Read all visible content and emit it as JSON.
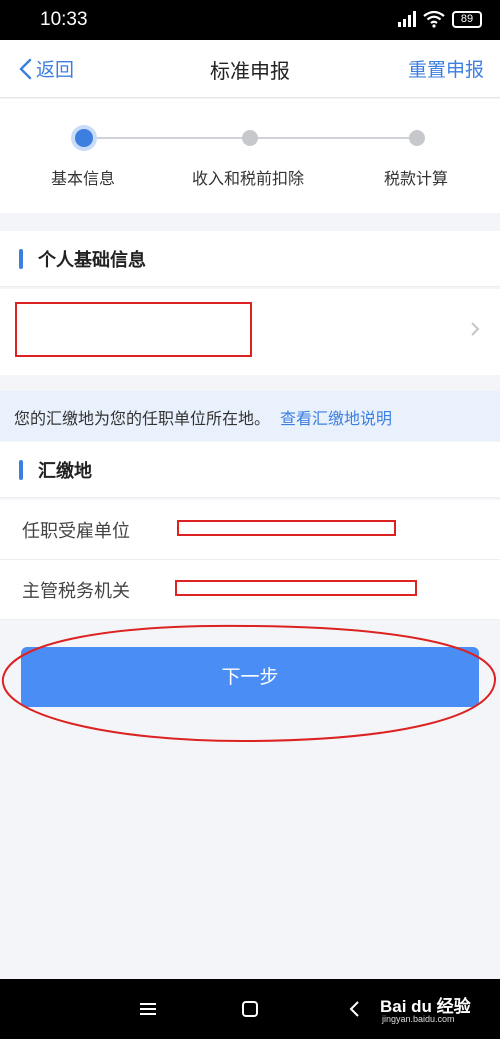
{
  "status_bar": {
    "time": "10:33",
    "battery": "89",
    "icons": [
      "signal-icon",
      "wifi-icon",
      "battery-icon"
    ]
  },
  "nav": {
    "back_label": "返回",
    "title": "标准申报",
    "reset_label": "重置申报"
  },
  "steps": [
    {
      "label": "基本信息",
      "active": true
    },
    {
      "label": "收入和税前扣除",
      "active": false
    },
    {
      "label": "税款计算",
      "active": false
    }
  ],
  "personal_section": {
    "title": "个人基础信息"
  },
  "notice": {
    "text": "您的汇缴地为您的任职单位所在地。",
    "link": "查看汇缴地说明"
  },
  "filing_section": {
    "title": "汇缴地",
    "fields": [
      {
        "label": "任职受雇单位"
      },
      {
        "label": "主管税务机关"
      }
    ]
  },
  "next_button": {
    "label": "下一步"
  },
  "watermark": {
    "brand": "Bai du 经验",
    "url": "jingyan.baidu.com"
  },
  "colors": {
    "accent": "#3d7fe0",
    "button": "#4a8ef5",
    "annotation_red": "#dd2222",
    "notice_bg": "#e9f1fc"
  }
}
